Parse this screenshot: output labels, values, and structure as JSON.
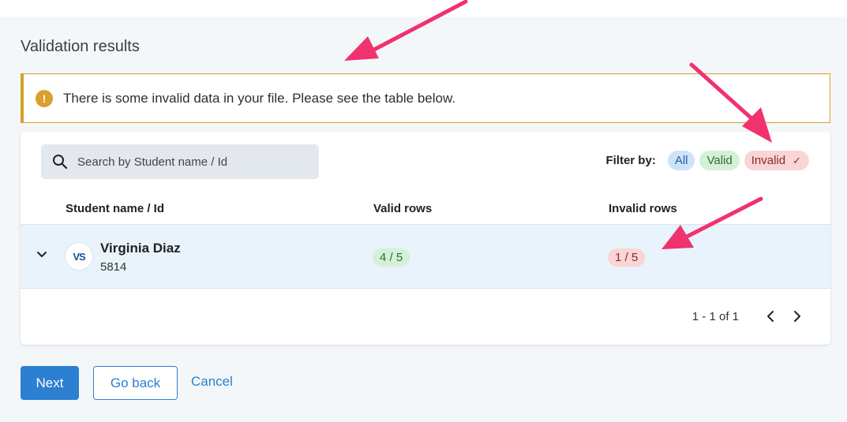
{
  "page": {
    "title": "Validation results"
  },
  "alert": {
    "icon": "exclamation-icon",
    "glyph": "!",
    "message": "There is some invalid data in your file. Please see the table below."
  },
  "search": {
    "placeholder": "Search by Student name / Id",
    "icon": "search-icon"
  },
  "filter": {
    "label": "Filter by:",
    "options": [
      "All",
      "Valid",
      "Invalid"
    ],
    "selected": "Invalid",
    "check_glyph": "✓"
  },
  "table": {
    "columns": [
      "Student name / Id",
      "Valid rows",
      "Invalid rows"
    ],
    "rows": [
      {
        "avatar_text": "VS",
        "name": "Virginia Diaz",
        "id": "5814",
        "valid": "4 / 5",
        "invalid": "1 / 5"
      }
    ]
  },
  "pagination": {
    "info": "1 - 1 of 1"
  },
  "actions": {
    "next": "Next",
    "back": "Go back",
    "cancel": "Cancel"
  },
  "colors": {
    "accent": "#2c7fd1",
    "warning": "#d6a12a",
    "annotation_arrow": "#f0326e",
    "row_highlight": "#e8f3fb"
  }
}
